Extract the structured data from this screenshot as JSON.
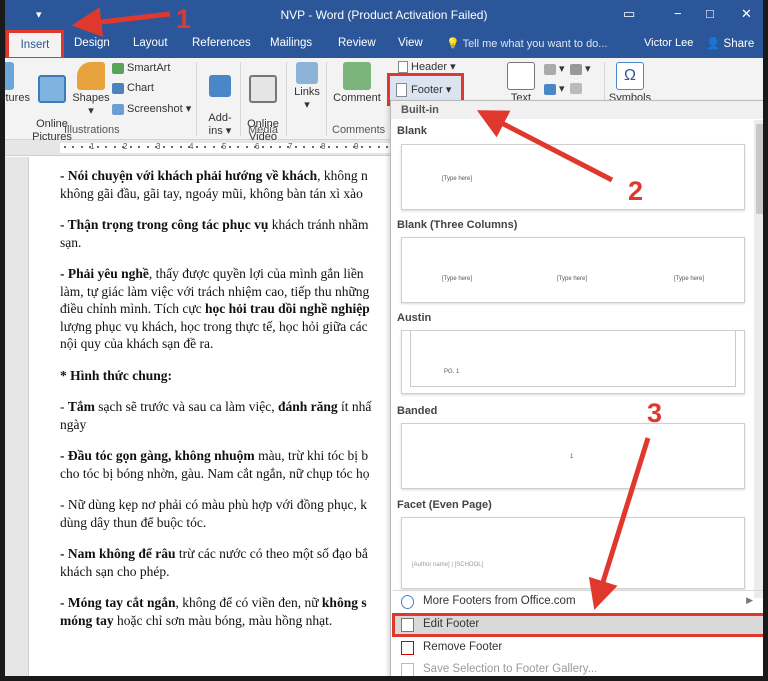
{
  "titlebar": {
    "title": "NVP - Word (Product Activation Failed)",
    "save_icon": "save-icon",
    "controls": [
      "−",
      "□",
      "✕"
    ],
    "restore_icon": "▭"
  },
  "tabs": {
    "insert": "Insert",
    "design": "Design",
    "layout": "Layout",
    "references": "References",
    "mailings": "Mailings",
    "review": "Review",
    "view": "View",
    "tell_me": "Tell me what you want to do...",
    "user": "Victor Lee",
    "share": "Share"
  },
  "ribbon": {
    "pictures": "ctures",
    "online_pictures": "Online\nPictures",
    "shapes": "Shapes",
    "smartart": "SmartArt",
    "chart": "Chart",
    "screenshot": "Screenshot",
    "illustrations_label": "Illustrations",
    "addins": "Add-\nins",
    "online_video": "Online\nVideo",
    "media_label": "Media",
    "links": "Links",
    "comment": "Comment",
    "comments_label": "Comments",
    "header": "Header",
    "footer": "Footer",
    "text": "Text",
    "symbols": "Symbols"
  },
  "ruler": {
    "numbers": [
      "1",
      "2",
      "3",
      "4",
      "5",
      "6",
      "7",
      "8",
      "9"
    ]
  },
  "document": {
    "p1_bold": "- Nói chuyện với khách phải hướng về khách",
    "p1_rest": ", không n",
    "p1_line2": "không gãi đầu, gãi tay, ngoáy mũi, không bàn tán xì xào",
    "p2_bold": "- Thận trọng trong công tác phục vụ",
    "p2_rest": " khách tránh nhầm",
    "p2_line2": "sạn.",
    "p3_bold": "- Phải yêu nghề",
    "p3_rest": ", thấy được quyền lợi của mình gắn liền",
    "p3_line2": "làm, tự giác làm việc với trách nhiệm cao, tiếp thu những",
    "p3_line3a": "điều chỉnh mình. Tích cực ",
    "p3_line3b": "học hỏi trau dồi nghề nghiệp",
    "p3_line4": "lượng phục vụ khách, học trong thực tế, học hỏi giữa các",
    "p3_line5": "nội quy của khách sạn đề ra.",
    "heading": "* Hình thức chung:",
    "p4_a": "- ",
    "p4_bold": "Tắm",
    "p4_rest": " sạch sẽ trước và sau ca làm việc, ",
    "p4_bold2": "đánh răng",
    "p4_rest2": " ít nhấ",
    "p4_line2": "ngày",
    "p5_bold": "- Đầu tóc gọn gàng, không nhuộm",
    "p5_rest": " màu, trừ khi tóc bị b",
    "p5_line2": "cho tóc bị bóng nhờn, gàu. Nam cắt ngắn, nữ chụp tóc họ",
    "p6_line1": "- Nữ dùng kẹp nơ phải có màu phù hợp với đồng phục, k",
    "p6_line2": "dùng dây thun để buộc tóc.",
    "p7_bold": "- Nam không để râu",
    "p7_rest": " trừ các nước có theo một số đạo bắ",
    "p7_line2": "khách sạn cho phép.",
    "p8_bold": "- Móng tay cắt ngắn",
    "p8_rest": ", không để có viền đen, nữ ",
    "p8_bold2": "không s",
    "p8_line2_bold": "móng tay",
    "p8_line2_rest": " hoặc chỉ sơn màu bóng, màu hồng nhạt."
  },
  "gallery": {
    "title": "Built-in",
    "sections": [
      {
        "label": "Blank",
        "placeholders": [
          "[Type here]"
        ]
      },
      {
        "label": "Blank (Three Columns)",
        "placeholders": [
          "[Type here]",
          "[Type here]",
          "[Type here]"
        ]
      },
      {
        "label": "Austin",
        "placeholders": [
          "PG. 1"
        ]
      },
      {
        "label": "Banded",
        "placeholders": [
          "1"
        ]
      },
      {
        "label": "Facet (Even Page)",
        "placeholders": [
          "[Author name] | [SCHOOL]"
        ]
      }
    ],
    "menu": {
      "more": "More Footers from Office.com",
      "edit": "Edit Footer",
      "remove": "Remove Footer",
      "save": "Save Selection to Footer Gallery..."
    }
  },
  "annotations": {
    "step1": "1",
    "step2": "2",
    "step3": "3",
    "arrow_color": "#e0382d"
  }
}
